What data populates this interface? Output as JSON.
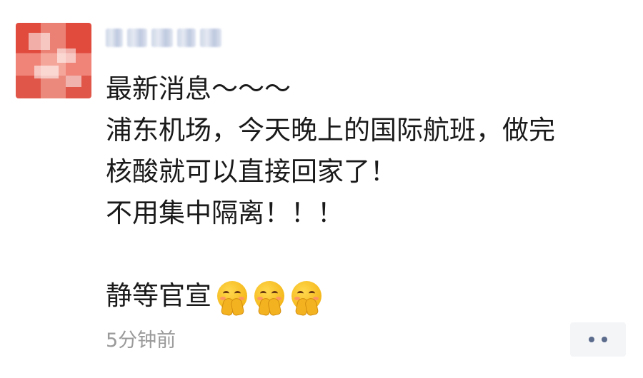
{
  "post": {
    "author_name": "",
    "lines": [
      "最新消息～～～",
      "浦东机场，今天晚上的国际航班，做完",
      "核酸就可以直接回家了！",
      "不用集中隔离！！！",
      "",
      "静等官宣"
    ],
    "emoji": [
      "hands-over-face-emoji",
      "hands-over-face-emoji",
      "hands-over-face-emoji"
    ],
    "timestamp": "5分钟前"
  },
  "colors": {
    "text": "#1a1a1a",
    "meta": "#9a9a9a",
    "more_dots": "#5b6b8c",
    "more_bg": "#f4f5f7"
  },
  "icons": {
    "more": "more-dots-icon"
  }
}
